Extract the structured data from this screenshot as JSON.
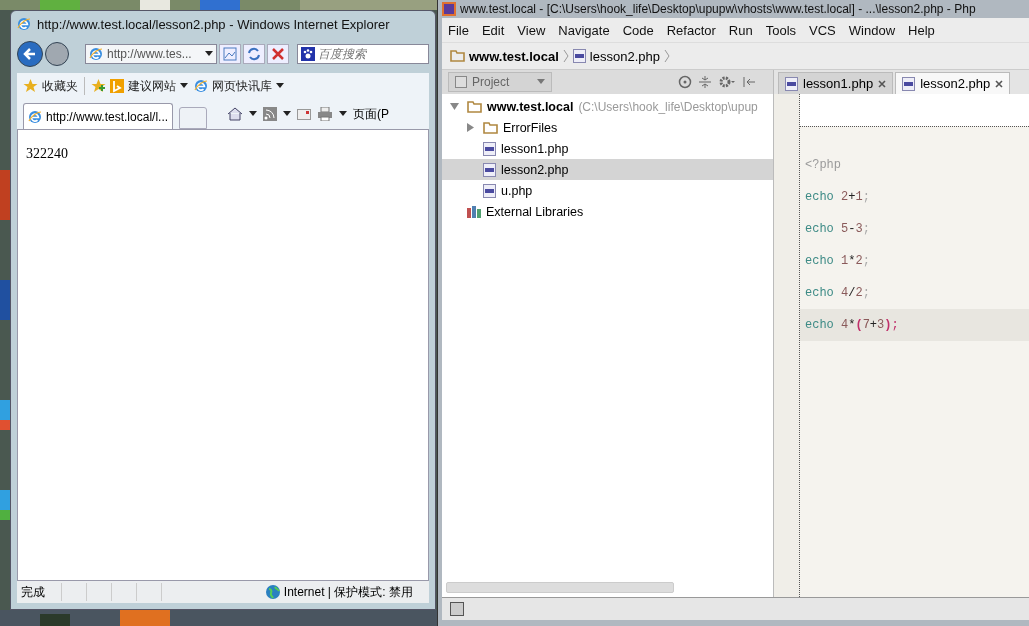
{
  "browser": {
    "title": "http://www.test.local/lesson2.php - Windows Internet Explorer",
    "address": "http://www.tes...",
    "search_placeholder": "百度搜索",
    "favorites": [
      {
        "label": "收藏夹",
        "kind": "star"
      },
      {
        "label": "建议网站",
        "kind": "bing"
      },
      {
        "label": "网页快讯库",
        "kind": "ie"
      }
    ],
    "tabs": [
      {
        "label": "http://www.test.local/l...",
        "selected": true
      }
    ],
    "command_label": "页面(P",
    "content": "322240",
    "status": {
      "text": "完成",
      "zone": "Internet | 保护模式: 禁用"
    }
  },
  "ide": {
    "title": "www.test.local - [C:\\Users\\hook_life\\Desktop\\upupw\\vhosts\\www.test.local] - ...\\lesson2.php - Php",
    "menu": [
      "File",
      "Edit",
      "View",
      "Navigate",
      "Code",
      "Refactor",
      "Run",
      "Tools",
      "VCS",
      "Window",
      "Help"
    ],
    "breadcrumb": [
      "www.test.local",
      "lesson2.php"
    ],
    "pane_selector": "Project",
    "tabs": [
      {
        "label": "lesson1.php",
        "selected": false
      },
      {
        "label": "lesson2.php",
        "selected": true
      }
    ],
    "tree": [
      {
        "label": "www.test.local",
        "kind": "root",
        "hint": "(C:\\Users\\hook_life\\Desktop\\upup",
        "expanded": true,
        "selected": false,
        "children": [
          {
            "label": "ErrorFiles",
            "kind": "folder",
            "expanded": false,
            "selected": false
          },
          {
            "label": "lesson1.php",
            "kind": "php",
            "selected": false
          },
          {
            "label": "lesson2.php",
            "kind": "php",
            "selected": true
          },
          {
            "label": "u.php",
            "kind": "php",
            "selected": false
          }
        ]
      },
      {
        "label": "External Libraries",
        "kind": "library",
        "selected": false
      }
    ],
    "code": [
      {
        "current": false,
        "tokens": [
          {
            "text": "<?php",
            "kind": "tag"
          }
        ]
      },
      {
        "current": false,
        "tokens": [
          {
            "text": "echo",
            "kind": "keyword"
          },
          {
            "text": " 2",
            "kind": "number"
          },
          {
            "text": "+",
            "kind": "op"
          },
          {
            "text": "1",
            "kind": "number"
          },
          {
            "text": ";",
            "kind": "punct"
          }
        ]
      },
      {
        "current": false,
        "tokens": [
          {
            "text": "echo",
            "kind": "keyword"
          },
          {
            "text": " 5",
            "kind": "number"
          },
          {
            "text": "-",
            "kind": "op"
          },
          {
            "text": "3",
            "kind": "number"
          },
          {
            "text": ";",
            "kind": "punct"
          }
        ]
      },
      {
        "current": false,
        "tokens": [
          {
            "text": "echo",
            "kind": "keyword"
          },
          {
            "text": " 1",
            "kind": "number"
          },
          {
            "text": "*",
            "kind": "op"
          },
          {
            "text": "2",
            "kind": "number"
          },
          {
            "text": ";",
            "kind": "punct"
          }
        ]
      },
      {
        "current": false,
        "tokens": [
          {
            "text": "echo",
            "kind": "keyword"
          },
          {
            "text": " 4",
            "kind": "number"
          },
          {
            "text": "/",
            "kind": "op"
          },
          {
            "text": "2",
            "kind": "number"
          },
          {
            "text": ";",
            "kind": "punct"
          }
        ]
      },
      {
        "current": true,
        "tokens": [
          {
            "text": "echo",
            "kind": "keyword"
          },
          {
            "text": " 4",
            "kind": "number"
          },
          {
            "text": "*",
            "kind": "op"
          },
          {
            "text": "(",
            "kind": "paren"
          },
          {
            "text": "7",
            "kind": "number"
          },
          {
            "text": "+",
            "kind": "op"
          },
          {
            "text": "3",
            "kind": "number"
          },
          {
            "text": ")",
            "kind": "paren"
          },
          {
            "text": ";",
            "kind": "semi"
          }
        ]
      }
    ]
  }
}
